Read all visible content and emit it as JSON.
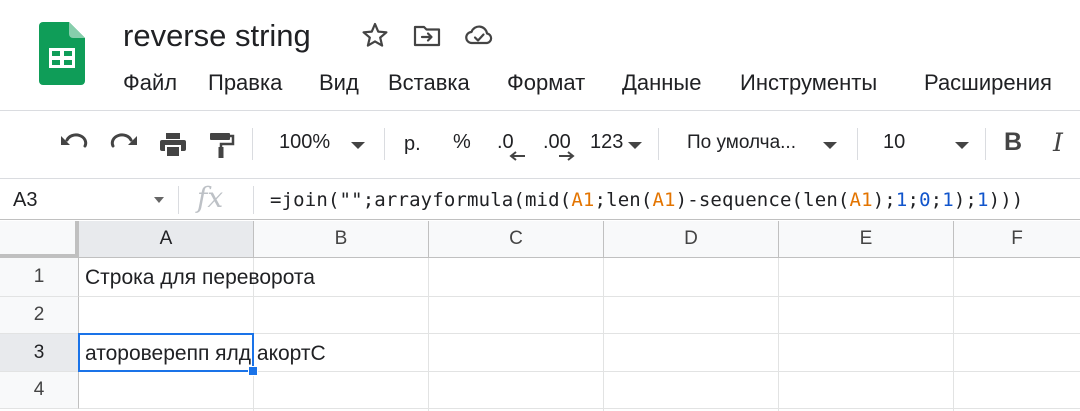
{
  "app": {
    "title": "reverse string",
    "icon_names": [
      "sheets-logo-icon",
      "star-icon",
      "move-to-folder-icon",
      "cloud-saved-icon"
    ]
  },
  "menu": [
    "Файл",
    "Правка",
    "Вид",
    "Вставка",
    "Формат",
    "Данные",
    "Инструменты",
    "Расширения"
  ],
  "toolbar": {
    "zoom": "100%",
    "currency": "р.",
    "percent": "%",
    "decrease_decimals": ".0",
    "increase_decimals": ".00",
    "more_formats": "123",
    "font": "По умолча...",
    "font_size": "10",
    "bold": "B",
    "italic": "I"
  },
  "formula_bar": {
    "name_box": "A3",
    "fx": "fx",
    "formula_parts": {
      "p1": "=join(\"\";arrayformula(mid(",
      "r1": "A1",
      "p2": ";len(",
      "r2": "A1",
      "p3": ")-sequence(len(",
      "r3": "A1",
      "p4": ");",
      "n1": "1",
      "p5": ";",
      "n2": "0",
      "p6": ";",
      "n3": "1",
      "p7": ");",
      "n4": "1",
      "p8": ")))"
    }
  },
  "grid": {
    "columns": [
      "A",
      "B",
      "C",
      "D",
      "E",
      "F"
    ],
    "rows": [
      "1",
      "2",
      "3",
      "4"
    ],
    "cells": {
      "A1": "Строка для переворота",
      "A3": "атороверепп ялд акортС"
    },
    "selected_cell": "A3",
    "colors": {
      "selection": "#1a73e8",
      "reference": "#e37400",
      "number": "#1155cc"
    }
  }
}
